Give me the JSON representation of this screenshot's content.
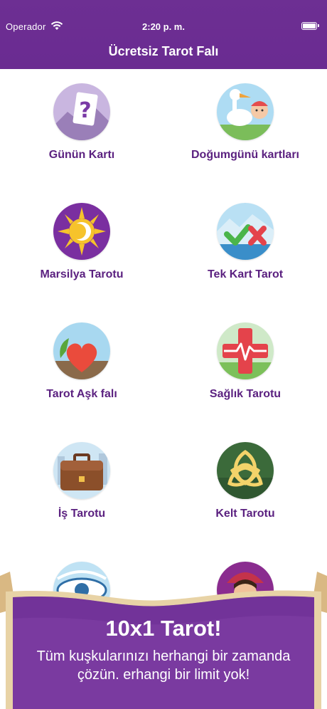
{
  "status_bar": {
    "carrier": "Operador",
    "time": "2:20 p. m."
  },
  "nav": {
    "title": "Ücretsiz Tarot Falı"
  },
  "items": [
    {
      "label": "Günün Kartı",
      "icon": "question-card-icon"
    },
    {
      "label": "Doğumgünü kartları",
      "icon": "stork-baby-icon"
    },
    {
      "label": "Marsilya Tarotu",
      "icon": "sun-moon-icon"
    },
    {
      "label": "Tek Kart Tarot",
      "icon": "check-cross-icon"
    },
    {
      "label": "Tarot Aşk falı",
      "icon": "heart-icon"
    },
    {
      "label": "Sağlık Tarotu",
      "icon": "health-cross-icon"
    },
    {
      "label": "İş Tarotu",
      "icon": "briefcase-icon"
    },
    {
      "label": "Kelt Tarotu",
      "icon": "celtic-knot-icon"
    },
    {
      "label": "",
      "icon": "eye-icon"
    },
    {
      "label": "",
      "icon": "fortune-teller-icon"
    }
  ],
  "banner": {
    "headline": "10x1 Tarot!",
    "line1": "Tüm kuşkularınızı herhangi bir zamanda",
    "line2": "çözün.  erhangi bir limit yok!"
  },
  "colors": {
    "primary": "#6a2b91",
    "label": "#5b2180",
    "parchment": "#e7cfa0"
  }
}
